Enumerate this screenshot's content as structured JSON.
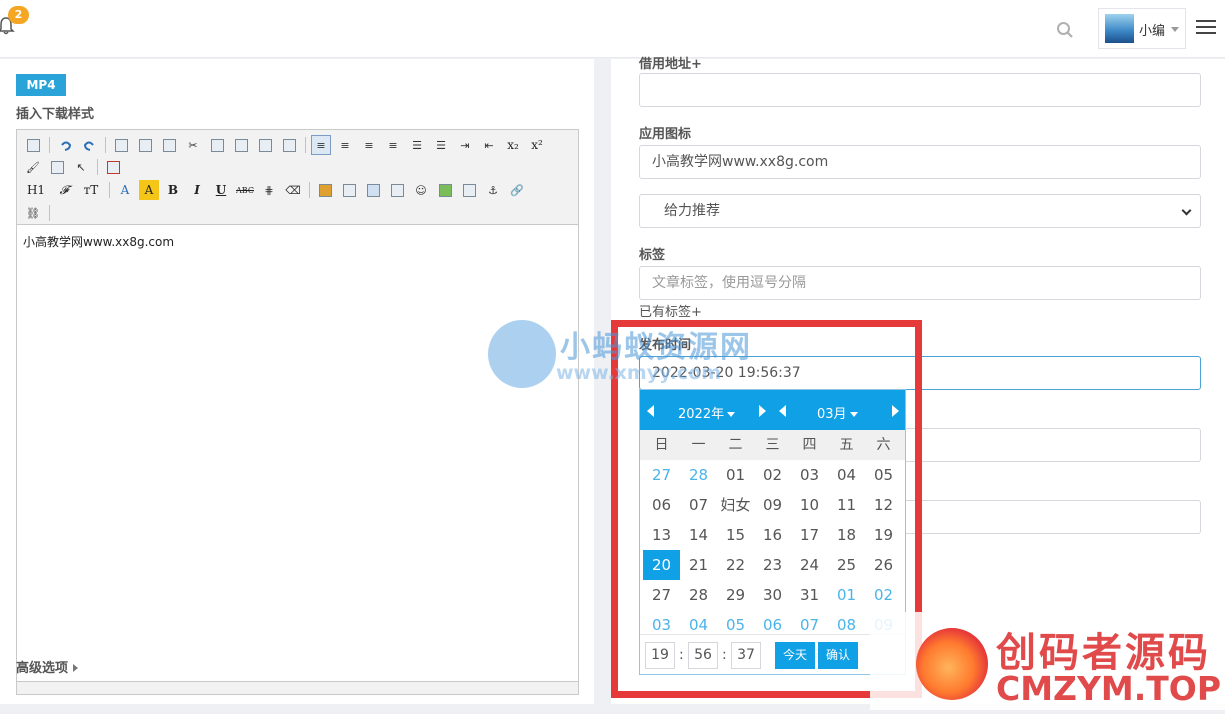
{
  "header": {
    "notification_count": "2",
    "user_name": "小编"
  },
  "left": {
    "mp4_tag": "MP4",
    "insert_label": "插入下载样式",
    "toolbar": {
      "h1": "H1",
      "font": "𝓕",
      "font_size": "тT",
      "font_color": "A",
      "bg_color": "A",
      "bold": "B",
      "italic": "I",
      "underline": "U",
      "strike": "ABC",
      "subscript": "x₂",
      "superscript": "x²"
    },
    "editor_content": "小高教学网www.xx8g.com",
    "advanced_label": "高级选项"
  },
  "right": {
    "partial_label": "借用地址+",
    "app_icon_label": "应用图标",
    "app_icon_value": "小高教学网www.xx8g.com",
    "select_value": "给力推荐",
    "tags_label": "标签",
    "tags_placeholder": "文章标签，使用逗号分隔",
    "existing_tags": "已有标签+",
    "publish_time_label": "发布时间",
    "publish_time_value": "2022-03-20 19:56:37"
  },
  "calendar": {
    "year": "2022年",
    "month": "03月",
    "weekdays": [
      "日",
      "一",
      "二",
      "三",
      "四",
      "五",
      "六"
    ],
    "days": [
      [
        "27",
        "28",
        "01",
        "02",
        "03",
        "04",
        "05"
      ],
      [
        "06",
        "07",
        "妇女",
        "09",
        "10",
        "11",
        "12"
      ],
      [
        "13",
        "14",
        "15",
        "16",
        "17",
        "18",
        "19"
      ],
      [
        "20",
        "21",
        "22",
        "23",
        "24",
        "25",
        "26"
      ],
      [
        "27",
        "28",
        "29",
        "30",
        "31",
        "01",
        "02"
      ],
      [
        "03",
        "04",
        "05",
        "06",
        "07",
        "08",
        "09"
      ]
    ],
    "selected_day": "20",
    "hour": "19",
    "minute": "56",
    "second": "37",
    "today_label": "今天",
    "confirm_label": "确认"
  },
  "watermarks": {
    "wm1_cn": "小蚂蚁资源网",
    "wm1_en": "www.xmyy.com",
    "wm2_cn": "创码者源码",
    "wm2_en": "CMZYM.TOP"
  },
  "colors": {
    "accent": "#10a0e6",
    "tag_blue": "#2aa3d9",
    "highlight_red": "#e63a3a"
  }
}
